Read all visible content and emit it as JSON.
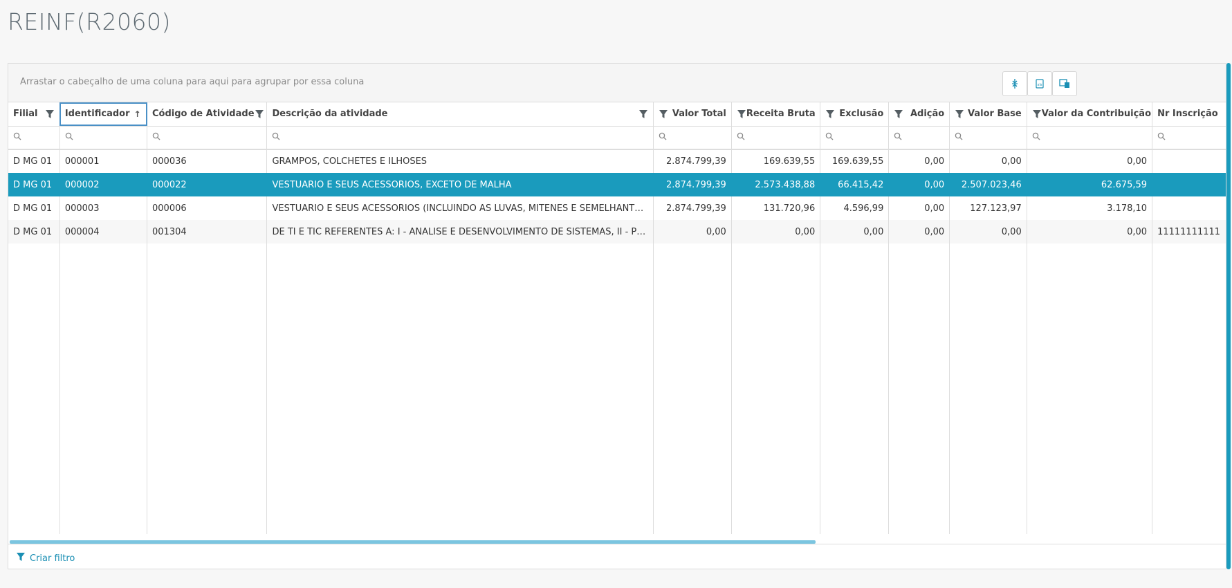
{
  "page": {
    "title": "REINF(R2060)"
  },
  "grid": {
    "group_hint": "Arrastar o cabeçalho de uma coluna para aqui para agrupar por essa coluna",
    "toolbar": [
      {
        "name": "column-chooser-icon"
      },
      {
        "name": "export-excel-icon"
      },
      {
        "name": "export-pdf-icon"
      }
    ],
    "columns": [
      {
        "label": "Filial",
        "align": "left"
      },
      {
        "label": "Identificador",
        "align": "left",
        "sort": "↑"
      },
      {
        "label": "Código de Atividade",
        "align": "left"
      },
      {
        "label": "Descrição da atividade",
        "align": "left"
      },
      {
        "label": "Valor Total",
        "align": "right"
      },
      {
        "label": "Receita Bruta",
        "align": "right"
      },
      {
        "label": "Exclusão",
        "align": "right"
      },
      {
        "label": "Adição",
        "align": "right"
      },
      {
        "label": "Valor Base",
        "align": "right"
      },
      {
        "label": "Valor da Contribuição",
        "align": "right"
      },
      {
        "label": "Nr Inscrição",
        "align": "left"
      }
    ],
    "rows": [
      [
        "D MG 01",
        "000001",
        "000036",
        "GRAMPOS, COLCHETES E ILHOSES",
        "2.874.799,39",
        "169.639,55",
        "169.639,55",
        "0,00",
        "0,00",
        "0,00",
        ""
      ],
      [
        "D MG 01",
        "000002",
        "000022",
        "VESTUARIO E SEUS ACESSORIOS, EXCETO DE MALHA",
        "2.874.799,39",
        "2.573.438,88",
        "66.415,42",
        "0,00",
        "2.507.023,46",
        "62.675,59",
        ""
      ],
      [
        "D MG 01",
        "000003",
        "000006",
        "VESTUARIO E SEUS ACESSORIOS (INCLUINDO AS LUVAS, MITENES E SEMELHANTES)",
        "2.874.799,39",
        "131.720,96",
        "4.596,99",
        "0,00",
        "127.123,97",
        "3.178,10",
        ""
      ],
      [
        "D MG 01",
        "000004",
        "001304",
        "DE TI E TIC REFERENTES A: I - ANALISE E DESENVOLVIMENTO DE SISTEMAS, II - PROGRAMAÇÃO",
        "0,00",
        "0,00",
        "0,00",
        "0,00",
        "0,00",
        "0,00",
        "11111111111"
      ]
    ],
    "selected_row": 1,
    "footer": {
      "create_filter": "Criar filtro"
    },
    "colors": {
      "accent": "#1a9bbd",
      "link": "#1a8fb4"
    }
  }
}
